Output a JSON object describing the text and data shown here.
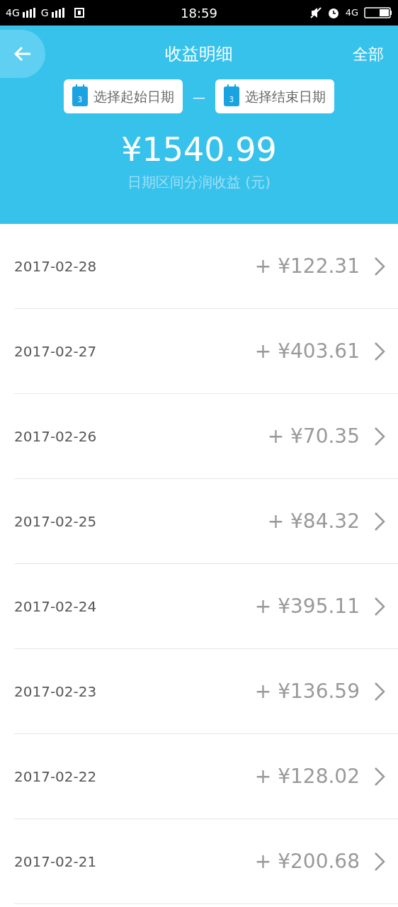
{
  "status_bar": {
    "network_1": "4G",
    "network_2": "G",
    "time": "18:59",
    "network_3": "4G"
  },
  "header": {
    "title": "收益明细",
    "action": "全部"
  },
  "date_range": {
    "start": {
      "label": "选择起始日期",
      "icon_text": "3"
    },
    "separator": "—",
    "end": {
      "label": "选择结束日期",
      "icon_text": "3"
    }
  },
  "total": {
    "amount": "¥1540.99",
    "caption": "日期区间分润收益 (元)"
  },
  "rows": [
    {
      "date": "2017-02-28",
      "amount": "+ ¥122.31"
    },
    {
      "date": "2017-02-27",
      "amount": "+ ¥403.61"
    },
    {
      "date": "2017-02-26",
      "amount": "+ ¥70.35"
    },
    {
      "date": "2017-02-25",
      "amount": "+ ¥84.32"
    },
    {
      "date": "2017-02-24",
      "amount": "+ ¥395.11"
    },
    {
      "date": "2017-02-23",
      "amount": "+ ¥136.59"
    },
    {
      "date": "2017-02-22",
      "amount": "+ ¥128.02"
    },
    {
      "date": "2017-02-21",
      "amount": "+ ¥200.68"
    }
  ]
}
